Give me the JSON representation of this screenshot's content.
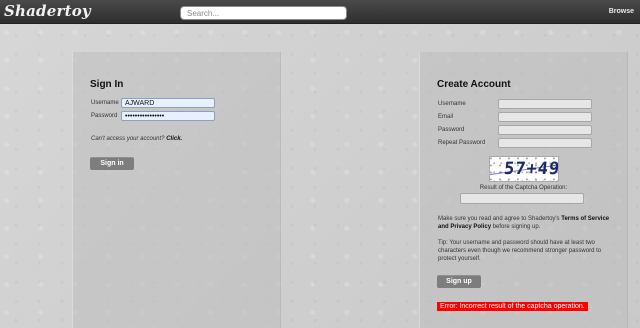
{
  "header": {
    "logo": "Shadertoy",
    "search_placeholder": "Search...",
    "browse": "Browse"
  },
  "signin": {
    "title": "Sign In",
    "username_label": "Username",
    "username_value": "AJWARD",
    "password_label": "Password",
    "password_value": "••••••••••••••••",
    "cant_access_text": "Can't access your account?",
    "cant_access_link": "Click.",
    "button": "Sign in"
  },
  "create": {
    "title": "Create Account",
    "username_label": "Username",
    "email_label": "Email",
    "password_label": "Password",
    "repeat_label": "Repeat Password",
    "captcha_text": "57+49",
    "captcha_result_label": "Result of the Captcha Operation:",
    "terms_pre": "Make sure you read and agree to Shadertoy's ",
    "terms_link": "Terms of Service and Privacy Policy",
    "terms_post": " before signing up.",
    "tip": "Tip: Your username and password should have at least two characters even though we recommend stronger password to protect yourself.",
    "button": "Sign up",
    "error": "Error: Incorrect result of the captcha operation."
  },
  "colors": {
    "topbar": "#3a3a3a",
    "button": "#7d7d7d",
    "error_bg": "#ff0000"
  }
}
